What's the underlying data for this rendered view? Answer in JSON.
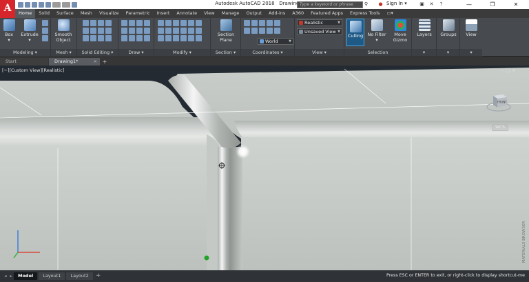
{
  "app": {
    "logo": "A",
    "title": "Autodesk AutoCAD 2018",
    "document": "Drawing1.dwg",
    "search_placeholder": "Type a keyword or phrase",
    "signin": "Sign In",
    "accent": "#d7262b"
  },
  "ribbon_tabs": [
    "Home",
    "Solid",
    "Surface",
    "Mesh",
    "Visualize",
    "Parametric",
    "Insert",
    "Annotate",
    "View",
    "Manage",
    "Output",
    "Add-ins",
    "A360",
    "Featured Apps",
    "Express Tools"
  ],
  "ribbon": {
    "modeling": {
      "label": "Modeling",
      "box": "Box",
      "extrude": "Extrude"
    },
    "mesh": {
      "label": "Mesh",
      "smooth_object_1": "Smooth",
      "smooth_object_2": "Object"
    },
    "solid_editing": {
      "label": "Solid Editing"
    },
    "draw": {
      "label": "Draw"
    },
    "modify": {
      "label": "Modify"
    },
    "section": {
      "label": "Section",
      "plane_1": "Section",
      "plane_2": "Plane"
    },
    "coordinates": {
      "label": "Coordinates",
      "ucs": "World"
    },
    "view": {
      "label": "View",
      "visual_style": "Realistic",
      "named_view": "Unsaved View"
    },
    "selection": {
      "label": "Selection",
      "culling": "Culling",
      "no_filter": "No Filter",
      "move_gizmo_1": "Move",
      "move_gizmo_2": "Gizmo"
    },
    "layers": "Layers",
    "groups": "Groups",
    "view_btn": "View"
  },
  "file_tabs": [
    "Start",
    "Drawing1*"
  ],
  "viewport": {
    "label": "[−][Custom View][Realistic]",
    "viewcube_face": "FRONT",
    "wcs": "WCS",
    "materials_browser": "MATERIALS BROWSER"
  },
  "layout_tabs": [
    "Model",
    "Layout1",
    "Layout2"
  ],
  "status_prompt": "Press ESC or ENTER to exit, or right-click to display shortcut-me"
}
